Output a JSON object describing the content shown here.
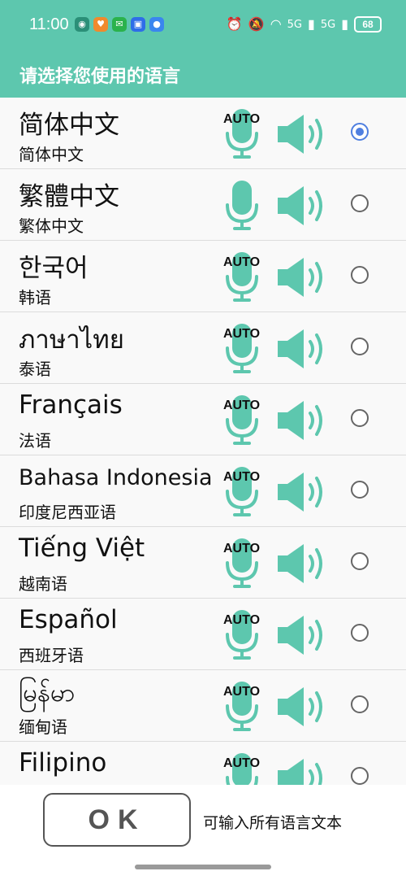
{
  "status": {
    "time": "11:00",
    "battery": "68",
    "net1": "5G",
    "net2": "5G"
  },
  "header": {
    "title": "请选择您使用的语言"
  },
  "auto_label": "AUTO",
  "languages": [
    {
      "name": "简体中文",
      "sub": "简体中文",
      "auto": true,
      "selected": true
    },
    {
      "name": "繁體中文",
      "sub": "繁体中文",
      "auto": false,
      "selected": false
    },
    {
      "name": "한국어",
      "sub": "韩语",
      "auto": true,
      "selected": false
    },
    {
      "name": "ภาษาไทย",
      "sub": "泰语",
      "auto": true,
      "selected": false
    },
    {
      "name": "Français",
      "sub": "法语",
      "auto": true,
      "selected": false
    },
    {
      "name": "Bahasa Indonesia",
      "sub": "印度尼西亚语",
      "auto": true,
      "selected": false
    },
    {
      "name": "Tiếng Việt",
      "sub": "越南语",
      "auto": true,
      "selected": false
    },
    {
      "name": "Español",
      "sub": "西班牙语",
      "auto": true,
      "selected": false
    },
    {
      "name": "မြန်မာ",
      "sub": "缅甸语",
      "auto": true,
      "selected": false
    },
    {
      "name": "Filipino",
      "sub": "",
      "auto": true,
      "selected": false
    }
  ],
  "footer": {
    "ok_label": "OK",
    "hint": "可输入所有语言文本"
  },
  "colors": {
    "accent": "#5dc7ae",
    "radio_selected": "#4f7fe0"
  },
  "icons": {
    "mic": "microphone-icon",
    "speaker": "speaker-icon"
  }
}
